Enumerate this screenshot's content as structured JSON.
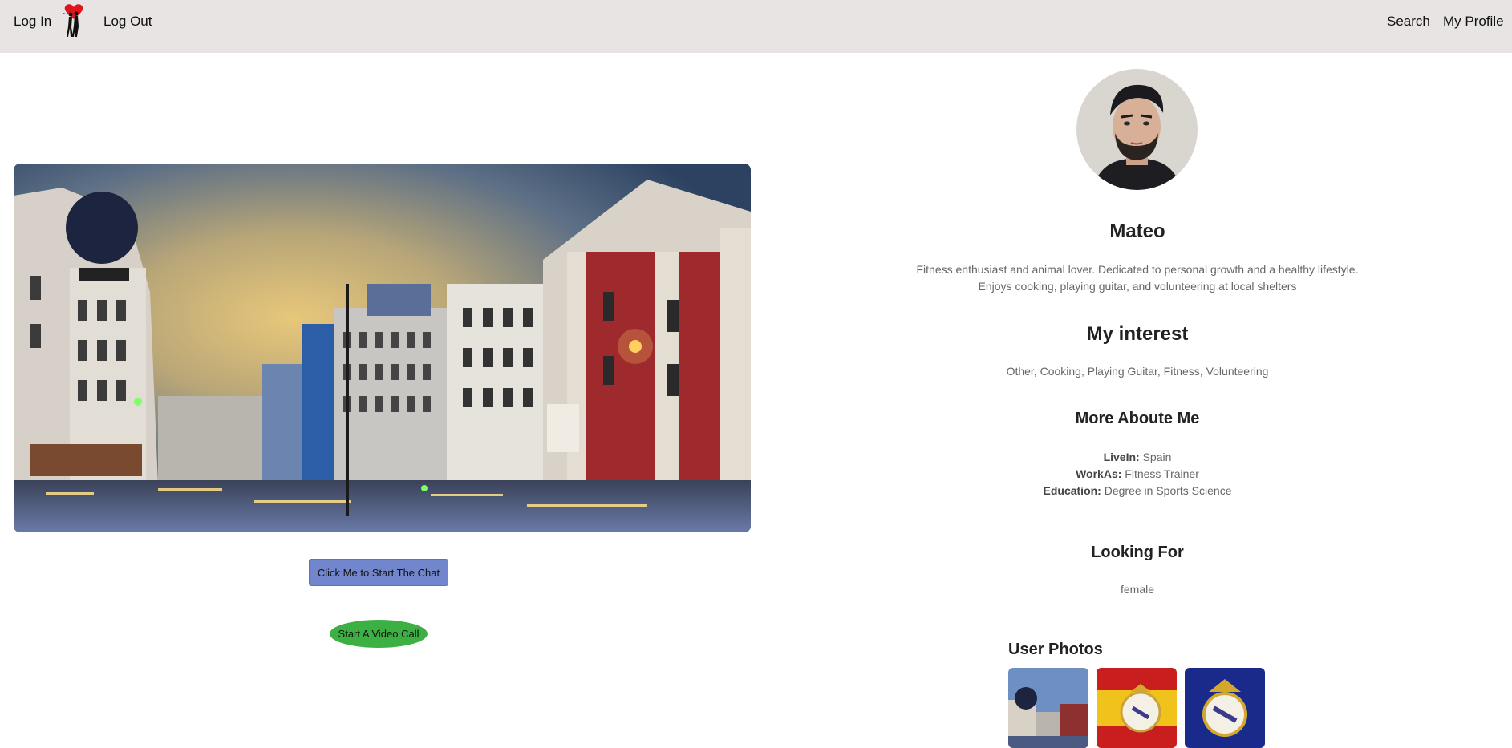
{
  "nav": {
    "login": "Log In",
    "logout": "Log Out",
    "search": "Search",
    "my_profile": "My Profile",
    "logo_icon": "heart-couple-logo-icon"
  },
  "actions": {
    "chat_button": "Click Me to Start The Chat",
    "video_button": "Start A Video Call"
  },
  "profile": {
    "name": "Mateo",
    "bio_line1": "Fitness enthusiast and animal lover. Dedicated to personal growth and a healthy lifestyle.",
    "bio_line2": "Enjoys cooking, playing guitar, and volunteering at local shelters",
    "interest_heading": "My interest",
    "interests": "Other, Cooking, Playing Guitar, Fitness, Volunteering",
    "more_heading": "More Aboute Me",
    "details": [
      {
        "label": "LiveIn:",
        "value": "Spain"
      },
      {
        "label": "WorkAs:",
        "value": "Fitness Trainer"
      },
      {
        "label": "Education:",
        "value": "Degree in Sports Science"
      }
    ],
    "looking_heading": "Looking For",
    "looking_for": "female",
    "photos_heading": "User Photos"
  },
  "colors": {
    "topbar": "#e8e4e3",
    "chat_button": "#7186cc",
    "video_button": "#3cb043"
  }
}
